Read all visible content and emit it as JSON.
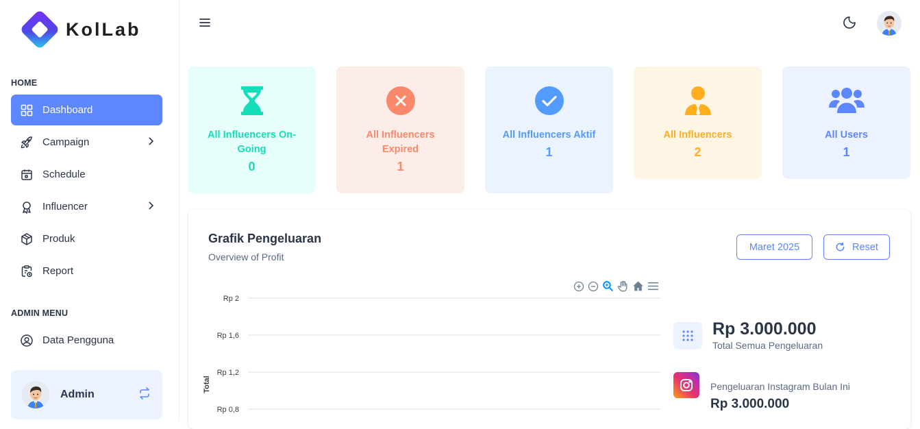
{
  "brand": {
    "name": "KolLab"
  },
  "sidebar": {
    "section_home": "HOME",
    "section_admin": "ADMIN MENU",
    "items": [
      {
        "label": "Dashboard",
        "icon": "grid-icon",
        "active": true
      },
      {
        "label": "Campaign",
        "icon": "rocket-icon",
        "has_submenu": true
      },
      {
        "label": "Schedule",
        "icon": "calendar-icon"
      },
      {
        "label": "Influencer",
        "icon": "award-icon",
        "has_submenu": true
      },
      {
        "label": "Produk",
        "icon": "box-icon"
      },
      {
        "label": "Report",
        "icon": "clipboard-icon"
      }
    ],
    "admin_items": [
      {
        "label": "Data Pengguna",
        "icon": "user-circle-icon"
      }
    ],
    "user": {
      "name": "Admin"
    }
  },
  "stats": [
    {
      "title": "All Influencers On-Going",
      "value": "0",
      "color": "#13deb9",
      "bg": "#e6fffa",
      "icon": "hourglass-icon"
    },
    {
      "title": "All Influencers Expired",
      "value": "1",
      "color": "#fa896b",
      "bg": "#fdede8",
      "icon": "x-circle-icon"
    },
    {
      "title": "All Influencers Aktif",
      "value": "1",
      "color": "#539bff",
      "bg": "#ebf3fe",
      "icon": "check-circle-icon"
    },
    {
      "title": "All Influencers",
      "value": "2",
      "color": "#ffae1f",
      "bg": "#fef5e5",
      "icon": "user-tie-icon"
    },
    {
      "title": "All Users",
      "value": "1",
      "color": "#5d87ff",
      "bg": "#ecf2ff",
      "icon": "users-icon"
    }
  ],
  "chart_panel": {
    "title": "Grafik Pengeluaran",
    "subtitle": "Overview of Profit",
    "month_button": "Maret 2025",
    "reset_button": "Reset",
    "total_amount": "Rp 3.000.000",
    "total_label": "Total Semua Pengeluaran",
    "instagram_label": "Pengeluaran Instagram Bulan Ini",
    "instagram_amount": "Rp 3.000.000"
  },
  "chart_data": {
    "type": "bar",
    "ylabel": "Total",
    "ytick_labels": [
      "Rp 2",
      "Rp 1,6",
      "Rp 1,2",
      "Rp 0,8"
    ],
    "ytick_values": [
      2,
      1.6,
      1.2,
      0.8
    ],
    "grid": true,
    "categories": [],
    "values": []
  }
}
